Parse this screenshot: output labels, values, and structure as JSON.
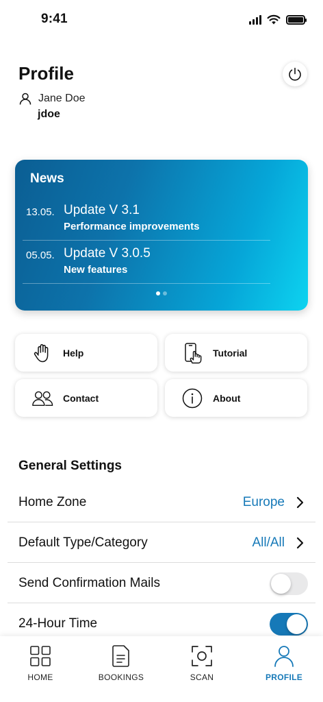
{
  "status_bar": {
    "time": "9:41"
  },
  "header": {
    "title": "Profile",
    "user_name": "Jane Doe",
    "user_handle": "jdoe"
  },
  "news": {
    "title": "News",
    "items": [
      {
        "date": "13.05.",
        "headline": "Update V 3.1",
        "subtitle": "Performance improvements"
      },
      {
        "date": "05.05.",
        "headline": "Update V 3.0.5",
        "subtitle": "New features"
      }
    ],
    "page_count": 2,
    "active_page": 1
  },
  "quick_actions": {
    "help": "Help",
    "tutorial": "Tutorial",
    "contact": "Contact",
    "about": "About"
  },
  "settings": {
    "title": "General Settings",
    "home_zone": {
      "label": "Home Zone",
      "value": "Europe"
    },
    "default_type": {
      "label": "Default Type/Category",
      "value": "All/All"
    },
    "confirmation_mails": {
      "label": "Send Confirmation Mails",
      "enabled": false
    },
    "hour_24": {
      "label": "24-Hour Time",
      "enabled": true
    }
  },
  "tab_bar": {
    "tabs": [
      {
        "label": "HOME",
        "icon": "home-grid-icon"
      },
      {
        "label": "BOOKINGS",
        "icon": "document-icon"
      },
      {
        "label": "SCAN",
        "icon": "scan-icon"
      },
      {
        "label": "PROFILE",
        "icon": "person-icon"
      }
    ],
    "active": "PROFILE"
  },
  "colors": {
    "accent": "#1679b8",
    "news_gradient_start": "#0b5e93",
    "news_gradient_end": "#0dd3f0"
  }
}
